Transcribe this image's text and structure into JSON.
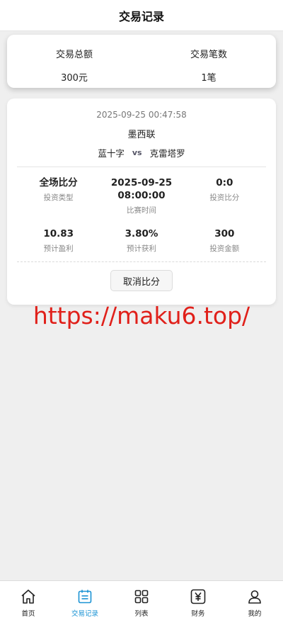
{
  "header": {
    "title": "交易记录"
  },
  "summary": {
    "total_amount_label": "交易总额",
    "total_amount_value": "300元",
    "total_count_label": "交易笔数",
    "total_count_value": "1笔"
  },
  "record": {
    "time": "2025-09-25 00:47:58",
    "league": "墨西联",
    "home_team": "蓝十字",
    "vs": "vs",
    "away_team": "克雷塔罗",
    "invest_type_value": "全场比分",
    "invest_type_label": "投资类型",
    "match_date": "2025-09-25",
    "match_time": "08:00:00",
    "match_time_label": "比赛时间",
    "invest_score_value": "0:0",
    "invest_score_label": "投资比分",
    "expected_profit_value": "10.83",
    "expected_profit_label": "预计盈利",
    "expected_rate_value": "3.80%",
    "expected_rate_label": "预计获利",
    "invest_amount_value": "300",
    "invest_amount_label": "投资金额",
    "cancel_label": "取消比分"
  },
  "watermark": "https://maku6.top/",
  "tabbar": {
    "active_color": "#1a93d4",
    "items": [
      {
        "label": "首页",
        "icon": "home-icon"
      },
      {
        "label": "交易记录",
        "icon": "records-icon"
      },
      {
        "label": "列表",
        "icon": "grid-icon"
      },
      {
        "label": "财务",
        "icon": "yen-icon"
      },
      {
        "label": "我的",
        "icon": "user-icon"
      }
    ]
  }
}
